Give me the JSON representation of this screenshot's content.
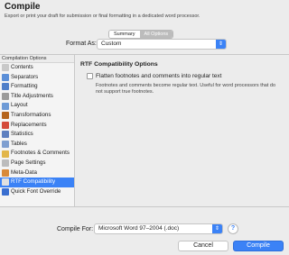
{
  "dialog": {
    "title": "Compile",
    "subtitle": "Export or print your draft for submission or final formatting in a dedicated word processor."
  },
  "tabs": [
    {
      "label": "Summary"
    },
    {
      "label": "All Options"
    }
  ],
  "format": {
    "label": "Format As:",
    "value": "Custom"
  },
  "sidebar": {
    "header": "Compilation Options",
    "items": [
      {
        "label": "Contents",
        "icon": "contents-icon",
        "color": "#c9c9c9"
      },
      {
        "label": "Separators",
        "icon": "separators-icon",
        "color": "#5b8fd8"
      },
      {
        "label": "Formatting",
        "icon": "formatting-icon",
        "color": "#4f7fc9"
      },
      {
        "label": "Title Adjustments",
        "icon": "title-adjustments-icon",
        "color": "#9b9b9b"
      },
      {
        "label": "Layout",
        "icon": "layout-icon",
        "color": "#6d9ad6"
      },
      {
        "label": "Transformations",
        "icon": "transformations-icon",
        "color": "#b5651d"
      },
      {
        "label": "Replacements",
        "icon": "replacements-icon",
        "color": "#d44a3a"
      },
      {
        "label": "Statistics",
        "icon": "statistics-icon",
        "color": "#5d7fbf"
      },
      {
        "label": "Tables",
        "icon": "tables-icon",
        "color": "#7f9fd0"
      },
      {
        "label": "Footnotes & Comments",
        "icon": "footnotes-icon",
        "color": "#e2b64a"
      },
      {
        "label": "Page Settings",
        "icon": "page-settings-icon",
        "color": "#bcbcbc"
      },
      {
        "label": "Meta-Data",
        "icon": "metadata-icon",
        "color": "#d98a3a"
      },
      {
        "label": "RTF Compatibility",
        "icon": "rtf-compatibility-icon",
        "color": "#e0e0e0"
      },
      {
        "label": "Quick Font Override",
        "icon": "font-override-icon",
        "color": "#3a6fd0"
      }
    ],
    "selected_index": 12
  },
  "content": {
    "title": "RTF Compatibility Options",
    "checkbox_label": "Flatten footnotes and comments into regular text",
    "checkbox_checked": false,
    "description": "Footnotes and comments become regular text. Useful for word processors that do not support true footnotes."
  },
  "compile_for": {
    "label": "Compile For:",
    "value": "Microsoft Word 97–2004 (.doc)"
  },
  "help_label": "?",
  "buttons": {
    "cancel": "Cancel",
    "compile": "Compile"
  },
  "colors": {
    "accent": "#3b82f6",
    "background": "#ececec"
  }
}
